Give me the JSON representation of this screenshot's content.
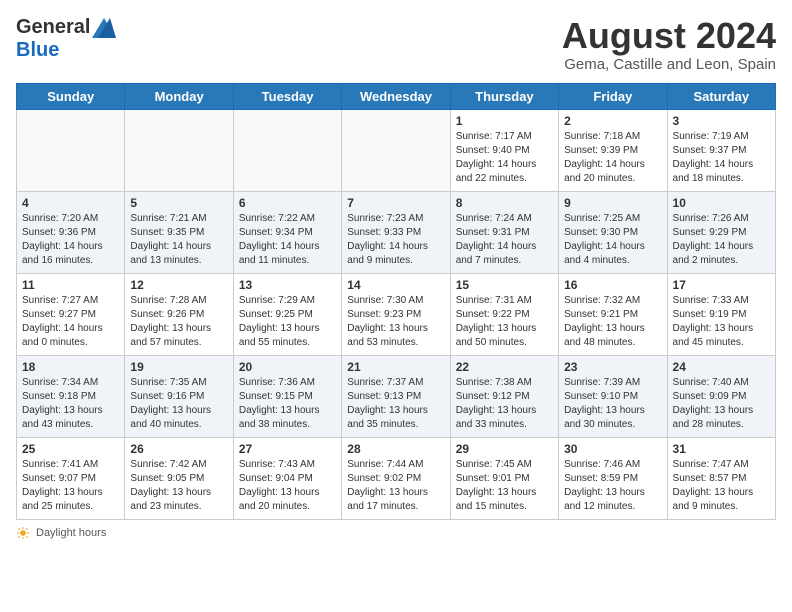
{
  "header": {
    "logo_general": "General",
    "logo_blue": "Blue",
    "month_year": "August 2024",
    "subtitle": "Gema, Castille and Leon, Spain"
  },
  "days_of_week": [
    "Sunday",
    "Monday",
    "Tuesday",
    "Wednesday",
    "Thursday",
    "Friday",
    "Saturday"
  ],
  "weeks": [
    [
      {
        "day": "",
        "info": ""
      },
      {
        "day": "",
        "info": ""
      },
      {
        "day": "",
        "info": ""
      },
      {
        "day": "",
        "info": ""
      },
      {
        "day": "1",
        "sunrise": "7:17 AM",
        "sunset": "9:40 PM",
        "daylight": "14 hours and 22 minutes."
      },
      {
        "day": "2",
        "sunrise": "7:18 AM",
        "sunset": "9:39 PM",
        "daylight": "14 hours and 20 minutes."
      },
      {
        "day": "3",
        "sunrise": "7:19 AM",
        "sunset": "9:37 PM",
        "daylight": "14 hours and 18 minutes."
      }
    ],
    [
      {
        "day": "4",
        "sunrise": "7:20 AM",
        "sunset": "9:36 PM",
        "daylight": "14 hours and 16 minutes."
      },
      {
        "day": "5",
        "sunrise": "7:21 AM",
        "sunset": "9:35 PM",
        "daylight": "14 hours and 13 minutes."
      },
      {
        "day": "6",
        "sunrise": "7:22 AM",
        "sunset": "9:34 PM",
        "daylight": "14 hours and 11 minutes."
      },
      {
        "day": "7",
        "sunrise": "7:23 AM",
        "sunset": "9:33 PM",
        "daylight": "14 hours and 9 minutes."
      },
      {
        "day": "8",
        "sunrise": "7:24 AM",
        "sunset": "9:31 PM",
        "daylight": "14 hours and 7 minutes."
      },
      {
        "day": "9",
        "sunrise": "7:25 AM",
        "sunset": "9:30 PM",
        "daylight": "14 hours and 4 minutes."
      },
      {
        "day": "10",
        "sunrise": "7:26 AM",
        "sunset": "9:29 PM",
        "daylight": "14 hours and 2 minutes."
      }
    ],
    [
      {
        "day": "11",
        "sunrise": "7:27 AM",
        "sunset": "9:27 PM",
        "daylight": "14 hours and 0 minutes."
      },
      {
        "day": "12",
        "sunrise": "7:28 AM",
        "sunset": "9:26 PM",
        "daylight": "13 hours and 57 minutes."
      },
      {
        "day": "13",
        "sunrise": "7:29 AM",
        "sunset": "9:25 PM",
        "daylight": "13 hours and 55 minutes."
      },
      {
        "day": "14",
        "sunrise": "7:30 AM",
        "sunset": "9:23 PM",
        "daylight": "13 hours and 53 minutes."
      },
      {
        "day": "15",
        "sunrise": "7:31 AM",
        "sunset": "9:22 PM",
        "daylight": "13 hours and 50 minutes."
      },
      {
        "day": "16",
        "sunrise": "7:32 AM",
        "sunset": "9:21 PM",
        "daylight": "13 hours and 48 minutes."
      },
      {
        "day": "17",
        "sunrise": "7:33 AM",
        "sunset": "9:19 PM",
        "daylight": "13 hours and 45 minutes."
      }
    ],
    [
      {
        "day": "18",
        "sunrise": "7:34 AM",
        "sunset": "9:18 PM",
        "daylight": "13 hours and 43 minutes."
      },
      {
        "day": "19",
        "sunrise": "7:35 AM",
        "sunset": "9:16 PM",
        "daylight": "13 hours and 40 minutes."
      },
      {
        "day": "20",
        "sunrise": "7:36 AM",
        "sunset": "9:15 PM",
        "daylight": "13 hours and 38 minutes."
      },
      {
        "day": "21",
        "sunrise": "7:37 AM",
        "sunset": "9:13 PM",
        "daylight": "13 hours and 35 minutes."
      },
      {
        "day": "22",
        "sunrise": "7:38 AM",
        "sunset": "9:12 PM",
        "daylight": "13 hours and 33 minutes."
      },
      {
        "day": "23",
        "sunrise": "7:39 AM",
        "sunset": "9:10 PM",
        "daylight": "13 hours and 30 minutes."
      },
      {
        "day": "24",
        "sunrise": "7:40 AM",
        "sunset": "9:09 PM",
        "daylight": "13 hours and 28 minutes."
      }
    ],
    [
      {
        "day": "25",
        "sunrise": "7:41 AM",
        "sunset": "9:07 PM",
        "daylight": "13 hours and 25 minutes."
      },
      {
        "day": "26",
        "sunrise": "7:42 AM",
        "sunset": "9:05 PM",
        "daylight": "13 hours and 23 minutes."
      },
      {
        "day": "27",
        "sunrise": "7:43 AM",
        "sunset": "9:04 PM",
        "daylight": "13 hours and 20 minutes."
      },
      {
        "day": "28",
        "sunrise": "7:44 AM",
        "sunset": "9:02 PM",
        "daylight": "13 hours and 17 minutes."
      },
      {
        "day": "29",
        "sunrise": "7:45 AM",
        "sunset": "9:01 PM",
        "daylight": "13 hours and 15 minutes."
      },
      {
        "day": "30",
        "sunrise": "7:46 AM",
        "sunset": "8:59 PM",
        "daylight": "13 hours and 12 minutes."
      },
      {
        "day": "31",
        "sunrise": "7:47 AM",
        "sunset": "8:57 PM",
        "daylight": "13 hours and 9 minutes."
      }
    ]
  ],
  "footer": {
    "daylight_label": "Daylight hours"
  }
}
